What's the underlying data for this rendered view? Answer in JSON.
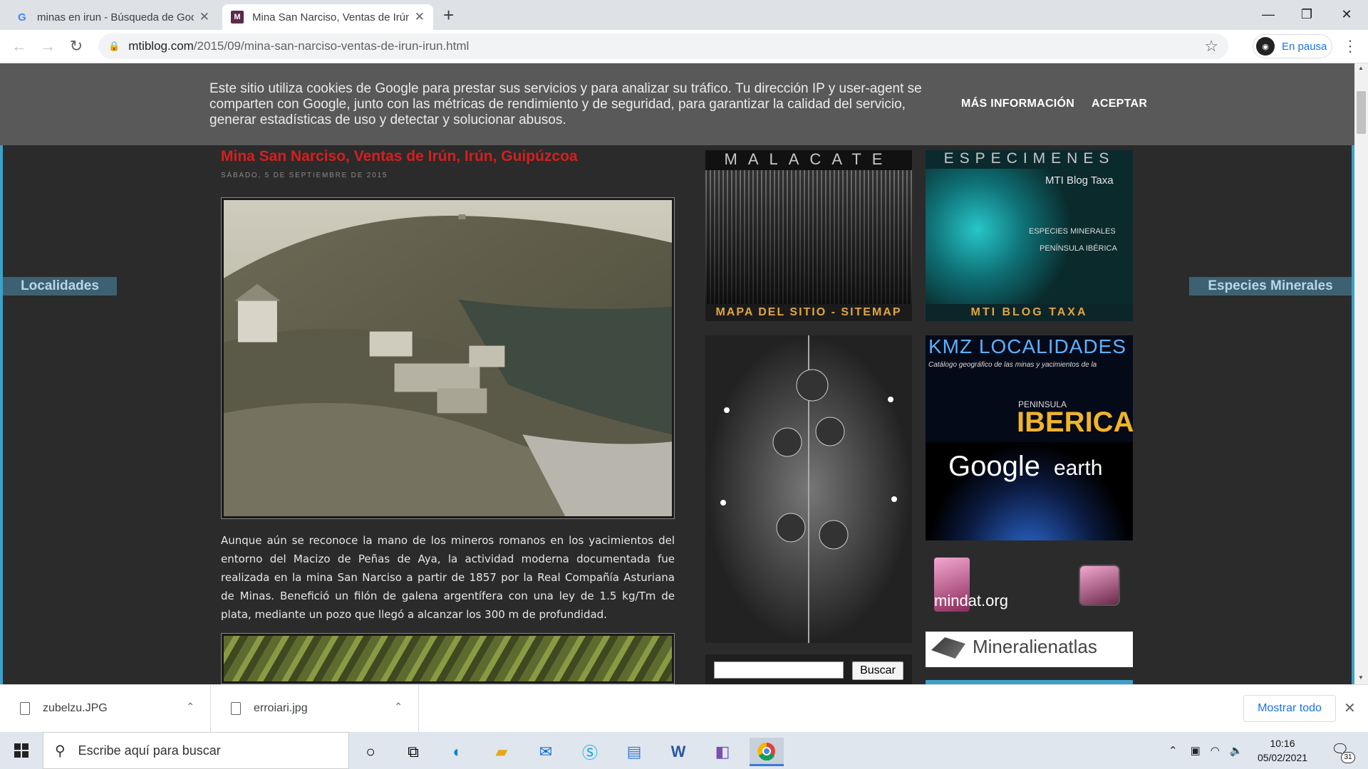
{
  "tabs": [
    {
      "title": "minas en irun - Búsqueda de Google",
      "favicon": "G"
    },
    {
      "title": "Mina San Narciso, Ventas de Irún, Irún, Guipúzcoa",
      "favicon": "M"
    }
  ],
  "new_tab": "+",
  "window_controls": {
    "minimize": "—",
    "maximize": "❐",
    "close": "✕"
  },
  "toolbar": {
    "back": "←",
    "forward": "→",
    "reload": "↻",
    "url_host": "mtiblog.com",
    "url_path": "/2015/09/mina-san-narciso-ventas-de-irun-irun.html",
    "star": "☆",
    "profile_label": "En pausa",
    "menu": "⋮"
  },
  "cookie_bar": {
    "text": "Este sitio utiliza cookies de Google para prestar sus servicios y para analizar su tráfico. Tu dirección IP y user-agent se comparten con Google, junto con las métricas de rendimiento y de seguridad, para garantizar la calidad del servicio, generar estadísticas de uso y detectar y solucionar abusos.",
    "more_info": "MÁS INFORMACIÓN",
    "accept": "ACEPTAR"
  },
  "side_tabs": {
    "left": "Localidades",
    "right": "Especies Minerales"
  },
  "post": {
    "title": "Mina San Narciso, Ventas de Irún, Irún, Guipúzcoa",
    "date": "SÁBADO, 5 DE SEPTIEMBRE DE 2015",
    "body": "Aunque aún se reconoce la mano de los mineros romanos en los yacimientos del entorno del Macizo de Peñas de Aya, la actividad moderna documentada fue realizada en la mina San Narciso a partir de 1857 por la Real Compañía Asturiana de Minas. Benefició un filón de galena argentífera con una ley de 1.5 kg/Tm de plata, mediante un pozo que llegó a alcanzar los 300 m de profundidad."
  },
  "widgets": {
    "malacate_top": "MALACATE",
    "malacate_bottom": "MAPA DEL SITIO - SITEMAP",
    "especimenes_top": "ESPECIMENES",
    "especimenes_caption": "MTI Blog Taxa",
    "especimenes_sub1": "ESPECIES MINERALES",
    "especimenes_sub2": "PENÍNSULA IBÉRICA",
    "especimenes_bottom": "MTI BLOG TAXA",
    "kmz_title": "KMZ LOCALIDADES",
    "kmz_sub": "Catálogo geográfico de las minas y yacimientos de la",
    "kmz_pen": "PENINSULA",
    "kmz_iberica": "IBERICA",
    "google_earth_1": "Google",
    "google_earth_2": "earth",
    "mindat": "mindat.org",
    "mineralienatlas": "Mineralienatlas",
    "search_button": "Buscar"
  },
  "downloads": [
    {
      "name": "zubelzu.JPG"
    },
    {
      "name": "erroiari.jpg"
    }
  ],
  "downloads_show_all": "Mostrar todo",
  "taskbar": {
    "search_placeholder": "Escribe aquí para buscar",
    "time": "10:16",
    "date": "05/02/2021",
    "notif_count": "31"
  }
}
